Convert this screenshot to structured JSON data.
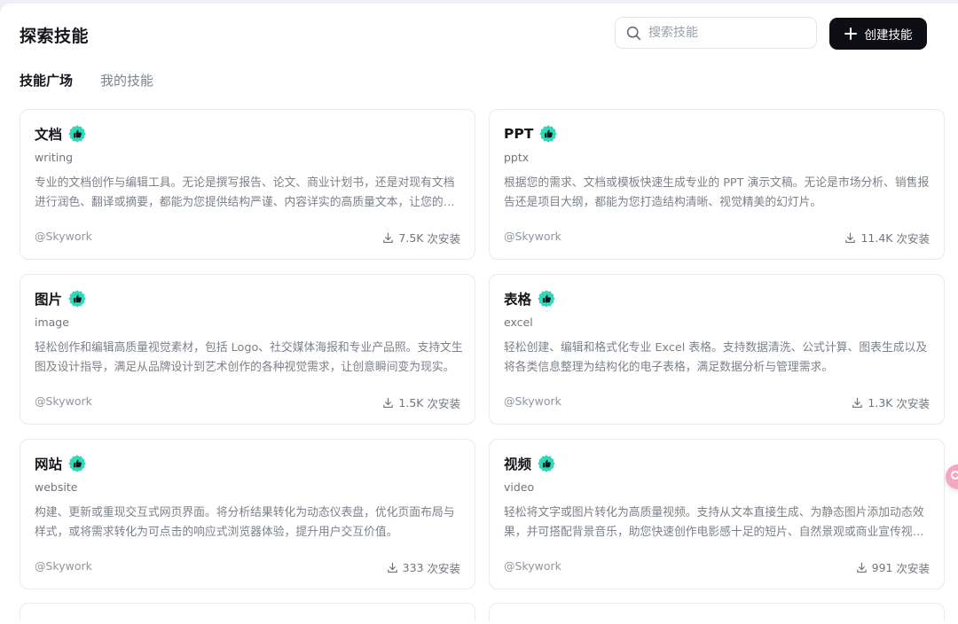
{
  "header": {
    "title": "探索技能",
    "search_placeholder": "搜索技能",
    "create_label": "创建技能"
  },
  "tabs": [
    {
      "label": "技能广场",
      "active": true
    },
    {
      "label": "我的技能",
      "active": false
    }
  ],
  "install_suffix": "次安装",
  "colors": {
    "badge": "#2ed8b8",
    "primary_button": "#0d0f14",
    "floating_button": "#f5a6c0"
  },
  "skills": [
    {
      "name": "文档",
      "slug": "writing",
      "description": "专业的文档创作与编辑工具。无论是撰写报告、论文、商业计划书，还是对现有文档进行润色、翻译或摘要，都能为您提供结构严谨、内容详实的高质量文本，让您的写作更加高效。",
      "author": "@Skywork",
      "installs": "7.5K",
      "badge_icon": "thumbs-up-icon"
    },
    {
      "name": "PPT",
      "slug": "pptx",
      "description": "根据您的需求、文档或模板快速生成专业的 PPT 演示文稿。无论是市场分析、销售报告还是项目大纲，都能为您打造结构清晰、视觉精美的幻灯片。",
      "author": "@Skywork",
      "installs": "11.4K",
      "badge_icon": "thumbs-up-icon"
    },
    {
      "name": "图片",
      "slug": "image",
      "description": "轻松创作和编辑高质量视觉素材，包括 Logo、社交媒体海报和专业产品照。支持文生图及设计指导，满足从品牌设计到艺术创作的各种视觉需求，让创意瞬间变为现实。",
      "author": "@Skywork",
      "installs": "1.5K",
      "badge_icon": "thumbs-up-icon"
    },
    {
      "name": "表格",
      "slug": "excel",
      "description": "轻松创建、编辑和格式化专业 Excel 表格。支持数据清洗、公式计算、图表生成以及将各类信息整理为结构化的电子表格，满足数据分析与管理需求。",
      "author": "@Skywork",
      "installs": "1.3K",
      "badge_icon": "thumbs-up-icon"
    },
    {
      "name": "网站",
      "slug": "website",
      "description": "构建、更新或重现交互式网页界面。将分析结果转化为动态仪表盘，优化页面布局与样式，或将需求转化为可点击的响应式浏览器体验，提升用户交互价值。",
      "author": "@Skywork",
      "installs": "333",
      "badge_icon": "thumbs-up-icon"
    },
    {
      "name": "视频",
      "slug": "video",
      "description": "轻松将文字或图片转化为高质量视频。支持从文本直接生成、为静态图片添加动态效果，并可搭配背景音乐，助您快速创作电影感十足的短片、自然景观或商业宣传视频。",
      "author": "@Skywork",
      "installs": "991",
      "badge_icon": "thumbs-up-icon"
    }
  ]
}
